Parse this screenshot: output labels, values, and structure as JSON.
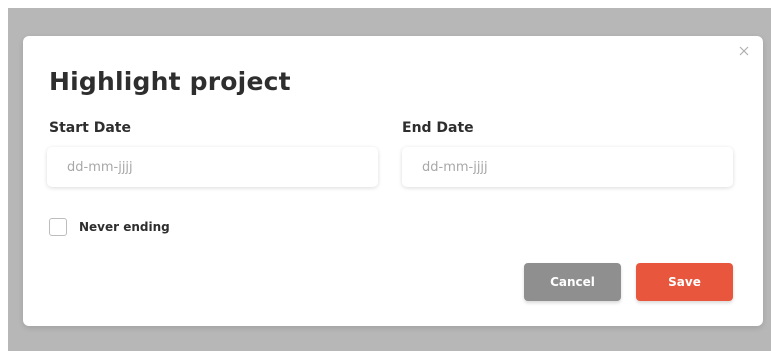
{
  "dialog": {
    "title": "Highlight project",
    "start_date": {
      "label": "Start Date",
      "value": "",
      "placeholder": "dd-mm-jjjj"
    },
    "end_date": {
      "label": "End Date",
      "value": "",
      "placeholder": "dd-mm-jjjj"
    },
    "never_ending": {
      "label": "Never ending",
      "checked": false
    },
    "buttons": {
      "cancel_label": "Cancel",
      "save_label": "Save"
    },
    "close_icon": "close-icon"
  },
  "colors": {
    "overlay": "#b7b7b7",
    "cancel": "#8f8f8f",
    "save": "#e8573d",
    "text": "#2e2e2e"
  }
}
